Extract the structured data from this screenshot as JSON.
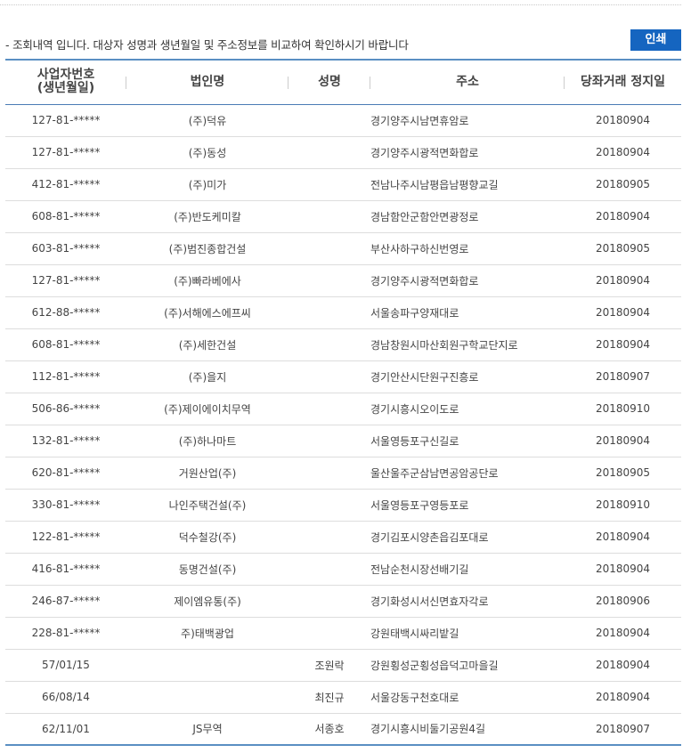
{
  "notice": "- 조회내역 입니다. 대상자 성명과 생년월일 및 주소정보를 비교하여 확인하시기 바랍니다",
  "print_button": "인쇄",
  "columns": {
    "biz_no_line1": "사업자번호",
    "biz_no_line2": "(생년월일)",
    "corp_name": "법인명",
    "person_name": "성명",
    "address": "주소",
    "suspension_date": "당좌거래 정지일"
  },
  "rows": [
    {
      "biz_no": "127-81-*****",
      "corp": "(주)덕유",
      "name": "",
      "addr": "경기양주시남면휴암로",
      "date": "20180904"
    },
    {
      "biz_no": "127-81-*****",
      "corp": "(주)동성",
      "name": "",
      "addr": "경기양주시광적면화합로",
      "date": "20180904"
    },
    {
      "biz_no": "412-81-*****",
      "corp": "(주)미가",
      "name": "",
      "addr": "전남나주시남평읍남평향교길",
      "date": "20180905"
    },
    {
      "biz_no": "608-81-*****",
      "corp": "(주)반도케미칼",
      "name": "",
      "addr": "경남함안군함안면광정로",
      "date": "20180904"
    },
    {
      "biz_no": "603-81-*****",
      "corp": "(주)범진종합건설",
      "name": "",
      "addr": "부산사하구하신번영로",
      "date": "20180905"
    },
    {
      "biz_no": "127-81-*****",
      "corp": "(주)빠라베에사",
      "name": "",
      "addr": "경기양주시광적면화합로",
      "date": "20180904"
    },
    {
      "biz_no": "612-88-*****",
      "corp": "(주)서해에스에프씨",
      "name": "",
      "addr": "서울송파구양재대로",
      "date": "20180904"
    },
    {
      "biz_no": "608-81-*****",
      "corp": "(주)세한건설",
      "name": "",
      "addr": "경남창원시마산회원구학교단지로",
      "date": "20180904"
    },
    {
      "biz_no": "112-81-*****",
      "corp": "(주)을지",
      "name": "",
      "addr": "경기안산시단원구진흥로",
      "date": "20180907"
    },
    {
      "biz_no": "506-86-*****",
      "corp": "(주)제이에이치무역",
      "name": "",
      "addr": "경기시흥시오이도로",
      "date": "20180910"
    },
    {
      "biz_no": "132-81-*****",
      "corp": "(주)하나마트",
      "name": "",
      "addr": "서울영등포구신길로",
      "date": "20180904"
    },
    {
      "biz_no": "620-81-*****",
      "corp": "거원산업(주)",
      "name": "",
      "addr": "울산울주군삼남면공암공단로",
      "date": "20180905"
    },
    {
      "biz_no": "330-81-*****",
      "corp": "나인주택건설(주)",
      "name": "",
      "addr": "서울영등포구영등포로",
      "date": "20180910"
    },
    {
      "biz_no": "122-81-*****",
      "corp": "덕수철강(주)",
      "name": "",
      "addr": "경기김포시양촌읍김포대로",
      "date": "20180904"
    },
    {
      "biz_no": "416-81-*****",
      "corp": "동명건설(주)",
      "name": "",
      "addr": "전남순천시장선배기길",
      "date": "20180904"
    },
    {
      "biz_no": "246-87-*****",
      "corp": "제이엠유통(주)",
      "name": "",
      "addr": "경기화성시서신면효자각로",
      "date": "20180906"
    },
    {
      "biz_no": "228-81-*****",
      "corp": "주)태백광업",
      "name": "",
      "addr": "강원태백시싸리밭길",
      "date": "20180904"
    },
    {
      "biz_no": "57/01/15",
      "corp": "",
      "name": "조원락",
      "addr": "강원횡성군횡성읍덕고마을길",
      "date": "20180904"
    },
    {
      "biz_no": "66/08/14",
      "corp": "",
      "name": "최진규",
      "addr": "서울강동구천호대로",
      "date": "20180904"
    },
    {
      "biz_no": "62/11/01",
      "corp": "JS무역",
      "name": "서종호",
      "addr": "경기시흥시비둘기공원4길",
      "date": "20180907"
    }
  ]
}
